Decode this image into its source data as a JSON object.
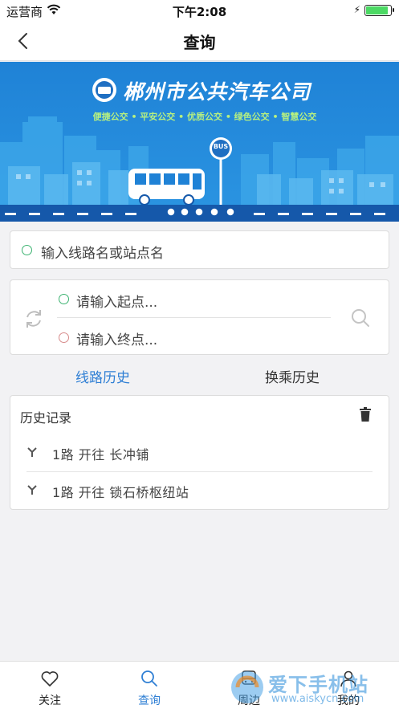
{
  "status_bar": {
    "carrier": "运营商",
    "time": "下午2:08",
    "battery_icon": "battery-icon",
    "wifi_icon": "wifi-icon"
  },
  "nav": {
    "title": "查询",
    "back_icon": "chevron-left-icon"
  },
  "banner": {
    "company_name": "郴州市公共汽车公司",
    "slogan": "便捷公交 • 平安公交 • 优质公交 • 绿色公交 • 智慧公交",
    "sign_text": "BUS",
    "colors": {
      "sky": "#1e7fd4",
      "road": "#1557a8"
    }
  },
  "search": {
    "placeholder": "输入线路名或站点名"
  },
  "route": {
    "start_placeholder": "请输入起点...",
    "end_placeholder": "请输入终点...",
    "swap_icon": "swap-icon",
    "search_icon": "search-icon"
  },
  "tabs": {
    "line_history": "线路历史",
    "transfer_history": "换乘历史",
    "active_color": "#2f7fd4"
  },
  "history": {
    "header": "历史记录",
    "delete_icon": "trash-icon",
    "items": [
      {
        "text": "1路 开往 长冲铺"
      },
      {
        "text": "1路 开往 锁石桥枢纽站"
      }
    ]
  },
  "bottom_nav": {
    "items": [
      {
        "label": "关注",
        "icon": "heart-icon"
      },
      {
        "label": "查询",
        "icon": "search-icon",
        "active": true
      },
      {
        "label": "周边",
        "icon": "bus-icon"
      },
      {
        "label": "我的",
        "icon": "person-icon"
      }
    ]
  },
  "watermark": {
    "brand": "爱下手机站",
    "url": "www.aiskycn.com"
  }
}
